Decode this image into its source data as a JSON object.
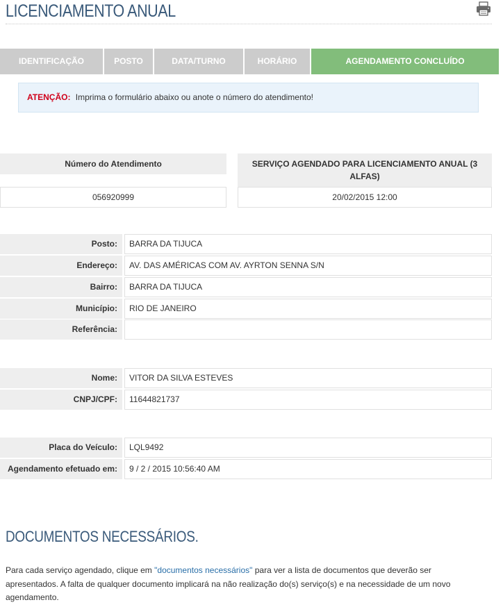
{
  "header": {
    "title": "LICENCIAMENTO ANUAL",
    "print_icon": "printer-icon"
  },
  "steps": [
    {
      "label": "IDENTIFICAÇÃO"
    },
    {
      "label": "POSTO"
    },
    {
      "label": "DATA/TURNO"
    },
    {
      "label": "HORÁRIO"
    },
    {
      "label": "AGENDAMENTO CONCLUÍDO"
    }
  ],
  "alert": {
    "label": "ATENÇÃO:",
    "text": "Imprima o formulário abaixo ou anote o número do atendimento!"
  },
  "summary": {
    "number_header": "Número do Atendimento",
    "number_value": "056920999",
    "service_header": "SERVIÇO AGENDADO PARA LICENCIAMENTO ANUAL (3 ALFAS)",
    "service_value": "20/02/2015 12:00"
  },
  "location": {
    "posto_label": "Posto:",
    "posto_value": "BARRA DA TIJUCA",
    "endereco_label": "Endereço:",
    "endereco_value": "AV. DAS AMÉRICAS COM AV. AYRTON SENNA S/N",
    "bairro_label": "Bairro:",
    "bairro_value": "BARRA DA TIJUCA",
    "municipio_label": "Município:",
    "municipio_value": "RIO DE JANEIRO",
    "referencia_label": "Referência:",
    "referencia_value": ""
  },
  "person": {
    "nome_label": "Nome:",
    "nome_value": "VITOR DA SILVA ESTEVES",
    "cpf_label": "CNPJ/CPF:",
    "cpf_value": "11644821737"
  },
  "vehicle": {
    "placa_label": "Placa do Veículo:",
    "placa_value": "LQL9492",
    "efetuado_label": "Agendamento efetuado em:",
    "efetuado_value": "9 / 2 / 2015 10:56:40 AM"
  },
  "docs": {
    "title": "DOCUMENTOS NECESSÁRIOS.",
    "text_before": "Para cada serviço agendado, clique em ",
    "link": "\"documentos necessários\"",
    "text_after": " para ver a lista de documentos que deverão ser apresentados. A falta de qualquer documento implicará na não realização do(s) serviço(s) e na necessidade de um novo agendamento."
  },
  "colors": {
    "title": "#3a5a7a",
    "step_inactive": "#cccccc",
    "step_active": "#82bd7b",
    "alert_label": "#d0021b",
    "link": "#2a6fa8"
  }
}
